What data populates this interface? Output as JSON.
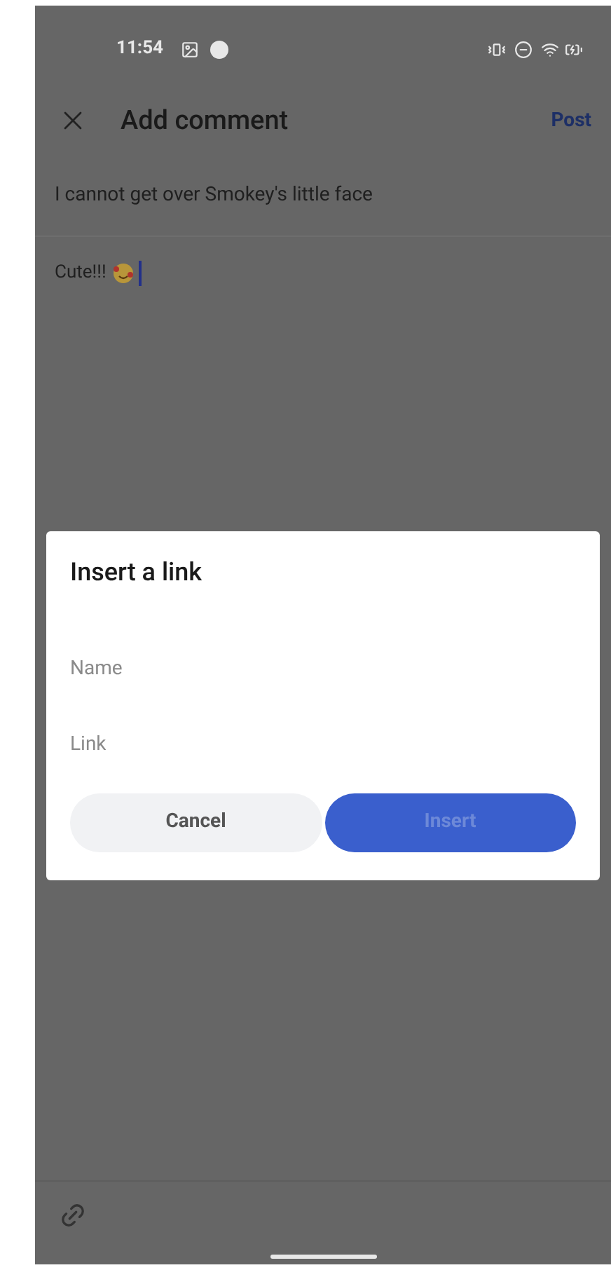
{
  "status_bar": {
    "time": "11:54"
  },
  "header": {
    "title": "Add comment",
    "action": "Post"
  },
  "original_comment": "I cannot get over Smokey's little face",
  "reply": {
    "value": "Cute!!!"
  },
  "dialog": {
    "title": "Insert a link",
    "fields": [
      {
        "placeholder": "Name"
      },
      {
        "placeholder": "Link"
      }
    ],
    "buttons": [
      {
        "label": "Cancel",
        "kind": "secondary",
        "disabled": false
      },
      {
        "label": "Insert",
        "kind": "primary",
        "disabled": true
      }
    ]
  }
}
